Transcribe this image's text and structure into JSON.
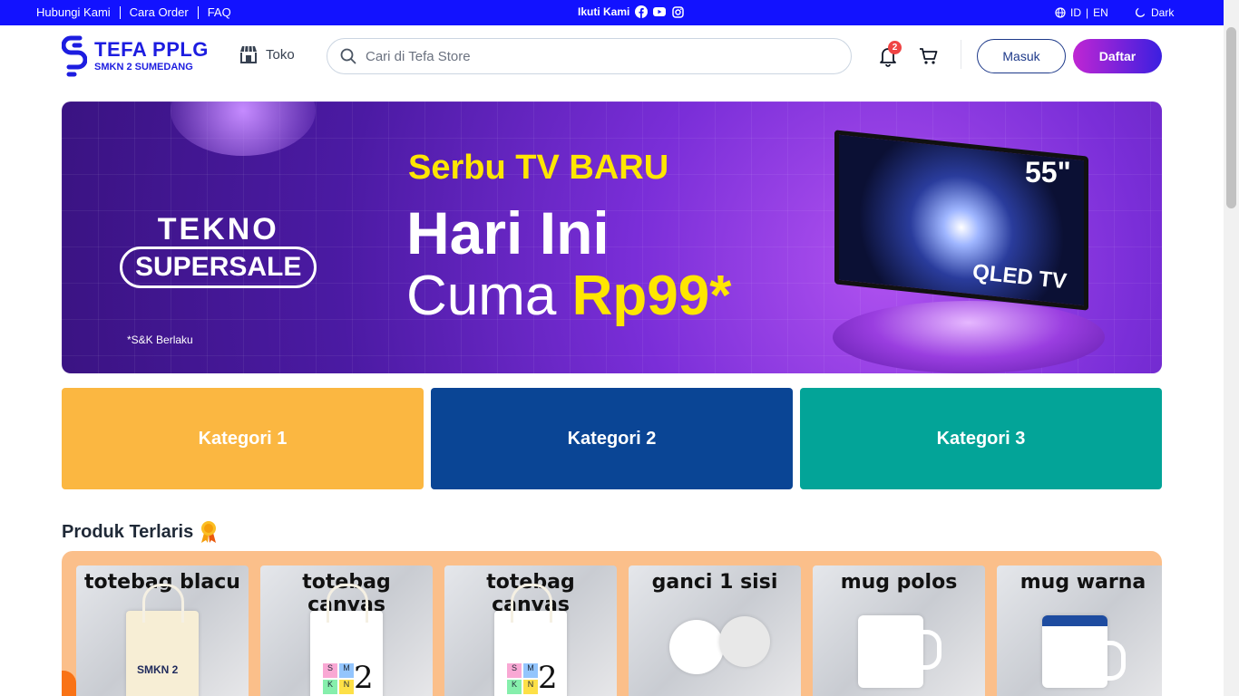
{
  "topbar": {
    "links": [
      "Hubungi Kami",
      "Cara Order",
      "FAQ"
    ],
    "follow_label": "Ikuti Kami",
    "social_icons": [
      "facebook-icon",
      "youtube-icon",
      "instagram-icon"
    ],
    "lang_id": "ID",
    "lang_sep": "|",
    "lang_en": "EN",
    "theme_label": "Dark"
  },
  "header": {
    "logo_title": "TEFA PPLG",
    "logo_subtitle": "SMKN 2 SUMEDANG",
    "store_label": "Toko",
    "search_placeholder": "Cari di Tefa Store",
    "notification_count": "2",
    "login_label": "Masuk",
    "register_label": "Daftar"
  },
  "banner": {
    "brand_line1": "TEKNO",
    "brand_line2": "SUPERSALE",
    "terms": "*S&K Berlaku",
    "headline": "Serbu TV BARU",
    "line1": "Hari Ini",
    "line2_prefix": "Cuma ",
    "line2_price": "Rp99*",
    "tv_size": "55\"",
    "tv_label": "QLED TV"
  },
  "categories": [
    {
      "label": "Kategori 1",
      "color": "#FBB741"
    },
    {
      "label": "Kategori 2",
      "color": "#0A4595"
    },
    {
      "label": "Kategori 3",
      "color": "#03A498"
    }
  ],
  "best_sellers": {
    "title": "Produk Terlaris",
    "icon": "award-ribbon-icon",
    "products": [
      {
        "name": "totebag blacu"
      },
      {
        "name": "totebag canvas"
      },
      {
        "name": "totebag canvas"
      },
      {
        "name": "ganci 1 sisi"
      },
      {
        "name": "mug polos"
      },
      {
        "name": "mug warna"
      }
    ]
  },
  "colors": {
    "topbar": "#1212FF",
    "brand": "#1D1DE0",
    "banner_accent": "#FFE600",
    "best_seller_bg": "#FBBF8A"
  }
}
